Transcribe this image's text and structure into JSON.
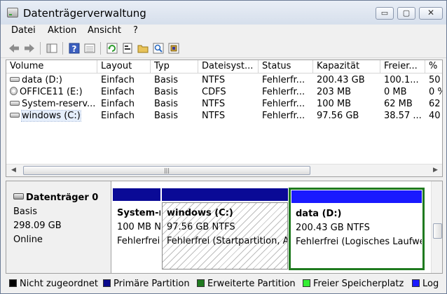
{
  "window": {
    "title": "Datenträgerverwaltung",
    "min": "▭",
    "max": "▢",
    "close": "✕"
  },
  "menu": [
    "Datei",
    "Aktion",
    "Ansicht",
    "?"
  ],
  "toolbar": {
    "icons": [
      "back-arrow-icon",
      "forward-arrow-icon",
      "console-tree-icon",
      "help-icon",
      "list-view-icon",
      "refresh-icon",
      "properties-icon",
      "open-folder-icon",
      "search-icon",
      "settings-icon"
    ]
  },
  "table": {
    "columns": [
      "Volume",
      "Layout",
      "Typ",
      "Dateisyst...",
      "Status",
      "Kapazität",
      "Freier...",
      "%"
    ],
    "rows": [
      {
        "icon": "drive-icon",
        "cells": [
          "data (D:)",
          "Einfach",
          "Basis",
          "NTFS",
          "Fehlerfr...",
          "200.43 GB",
          "100.1...",
          "50"
        ]
      },
      {
        "icon": "cd-drive-icon",
        "cells": [
          "OFFICE11 (E:)",
          "Einfach",
          "Basis",
          "CDFS",
          "Fehlerfr...",
          "203 MB",
          "0 MB",
          "0 %"
        ]
      },
      {
        "icon": "drive-icon",
        "cells": [
          "System-reserv...",
          "Einfach",
          "Basis",
          "NTFS",
          "Fehlerfr...",
          "100 MB",
          "62 MB",
          "62"
        ]
      },
      {
        "icon": "drive-icon",
        "cells": [
          "windows (C:)",
          "Einfach",
          "Basis",
          "NTFS",
          "Fehlerfr...",
          "97.56 GB",
          "38.57 ...",
          "40"
        ]
      }
    ]
  },
  "disk": {
    "title": "Datenträger 0",
    "type": "Basis",
    "size": "298.09 GB",
    "state": "Online",
    "partitions": [
      {
        "name": "System-r",
        "size": "100 MB N",
        "status": "Fehlerfrei",
        "bar_color": "#0a0a96"
      },
      {
        "name": "windows  (C:)",
        "size": "97.56 GB NTFS",
        "status": "Fehlerfrei (Startpartition, Au",
        "bar_color": "#0a0a96"
      },
      {
        "name": "data  (D:)",
        "size": "200.43 GB NTFS",
        "status": "Fehlerfrei (Logisches Laufwe",
        "bar_color": "#1a1aff",
        "frame_color": "#1f7a1f"
      }
    ]
  },
  "legend": [
    {
      "label": "Nicht zugeordnet",
      "color": "#000000"
    },
    {
      "label": "Primäre Partition",
      "color": "#0a0a8c"
    },
    {
      "label": "Erweiterte Partition",
      "color": "#1f7a1f"
    },
    {
      "label": "Freier Speicherplatz",
      "color": "#33ee33"
    },
    {
      "label": "Log",
      "color": "#1a1aff"
    }
  ]
}
